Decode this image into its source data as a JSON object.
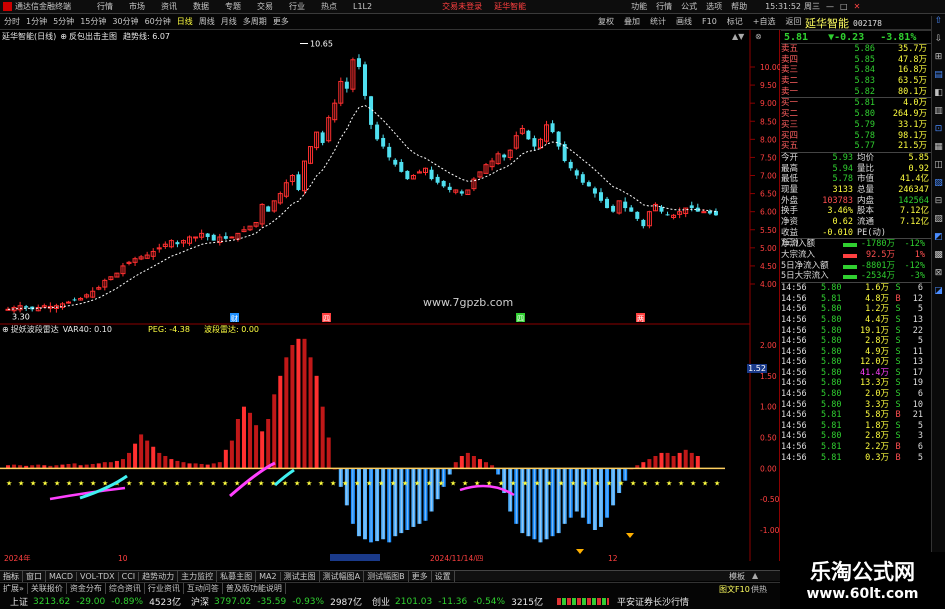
{
  "window": {
    "title": "通达信金融终端",
    "time": "15:31:52",
    "weekday": "周三",
    "menus": [
      "行情",
      "市场",
      "资讯",
      "数据",
      "专题",
      "交易",
      "行业",
      "热点",
      "L1L2"
    ],
    "right_menus": [
      "功能",
      "行情",
      "公式",
      "选项",
      "帮助"
    ],
    "center_links": [
      "交易未登录",
      "延华智能"
    ]
  },
  "toolbar": {
    "periods": [
      "分时",
      "1分钟",
      "5分钟",
      "15分钟",
      "30分钟",
      "60分钟",
      "日线",
      "周线",
      "月线",
      "多周期",
      "更多"
    ],
    "actions": [
      "复权",
      "叠加",
      "统计",
      "画线",
      "F10",
      "标记",
      "+自选",
      "返回"
    ]
  },
  "main_chart": {
    "legend": "延华智能(日线)",
    "legend2": "反包出击主图",
    "trend_label": "趋势线: 6.07",
    "high_label": "10.65",
    "low_label": "3.30",
    "watermark": "www.7gpzb.com",
    "marks": [
      "财",
      "四",
      "四",
      "两"
    ],
    "yticks": [
      "10.00",
      "9.50",
      "9.00",
      "8.50",
      "8.00",
      "7.50",
      "7.00",
      "6.50",
      "6.00",
      "5.50",
      "5.00",
      "4.50",
      "4.00"
    ]
  },
  "sub_chart": {
    "legend": "捉妖波段雷达",
    "var40": "VAR40: 0.10",
    "peg": "PEG: -4.38",
    "radar": "波段雷达: 0.00",
    "yticks": [
      "2.00",
      "1.50",
      "1.00",
      "0.50",
      "0.00",
      "-0.50",
      "-1.00"
    ],
    "cursor_value": "1.52",
    "xlabels": [
      "2024年",
      "10",
      "11",
      "2024/11/14/四",
      "12",
      "1"
    ]
  },
  "stock": {
    "name": "延华智能",
    "code": "002178",
    "price": "5.81",
    "change": "▼-0.23",
    "pct": "-3.81%",
    "asks": [
      {
        "l": "卖五",
        "p": "5.86",
        "v": "35.7万"
      },
      {
        "l": "卖四",
        "p": "5.85",
        "v": "47.8万"
      },
      {
        "l": "卖三",
        "p": "5.84",
        "v": "16.8万"
      },
      {
        "l": "卖二",
        "p": "5.83",
        "v": "63.5万"
      },
      {
        "l": "卖一",
        "p": "5.82",
        "v": "80.1万"
      }
    ],
    "bids": [
      {
        "l": "买一",
        "p": "5.81",
        "v": "4.0万"
      },
      {
        "l": "买二",
        "p": "5.80",
        "v": "264.9万"
      },
      {
        "l": "买三",
        "p": "5.79",
        "v": "33.1万"
      },
      {
        "l": "买四",
        "p": "5.78",
        "v": "98.1万"
      },
      {
        "l": "买五",
        "p": "5.77",
        "v": "21.5万"
      }
    ],
    "stats": [
      [
        "今开",
        "5.93",
        "均价",
        "5.85"
      ],
      [
        "最高",
        "5.94",
        "量比",
        "0.92"
      ],
      [
        "最低",
        "5.78",
        "市值",
        "41.4亿"
      ],
      [
        "现量",
        "3133",
        "总量",
        "246347"
      ],
      [
        "外盘",
        "103783",
        "内盘",
        "142564"
      ],
      [
        "换手",
        "3.46%",
        "股本",
        "7.12亿"
      ],
      [
        "净资",
        "0.62",
        "流通",
        "7.12亿"
      ],
      [
        "收益(三)",
        "-0.010",
        "PE(动)",
        ""
      ]
    ],
    "flows": [
      [
        "净流入额",
        "-1780万",
        "-12%"
      ],
      [
        "大宗流入",
        "92.5万",
        "1%"
      ],
      [
        "5日净流入额",
        "-8801万",
        "-12%"
      ],
      [
        "5日大宗流入",
        "-2534万",
        "-3%"
      ]
    ],
    "ticks": [
      [
        "14:56",
        "5.80",
        "1.6万",
        "S",
        "6"
      ],
      [
        "14:56",
        "5.81",
        "4.8万",
        "B",
        "12"
      ],
      [
        "14:56",
        "5.80",
        "1.2万",
        "S",
        "5"
      ],
      [
        "14:56",
        "5.80",
        "4.4万",
        "S",
        "13"
      ],
      [
        "14:56",
        "5.80",
        "19.1万",
        "S",
        "22"
      ],
      [
        "14:56",
        "5.80",
        "2.8万",
        "S",
        "5"
      ],
      [
        "14:56",
        "5.80",
        "4.9万",
        "S",
        "11"
      ],
      [
        "14:56",
        "5.80",
        "12.0万",
        "S",
        "13"
      ],
      [
        "14:56",
        "5.80",
        "41.4万",
        "S",
        "17"
      ],
      [
        "14:56",
        "5.80",
        "13.3万",
        "S",
        "19"
      ],
      [
        "14:56",
        "5.80",
        "2.0万",
        "S",
        "6"
      ],
      [
        "14:56",
        "5.80",
        "3.3万",
        "S",
        "10"
      ],
      [
        "14:56",
        "5.81",
        "5.8万",
        "B",
        "21"
      ],
      [
        "14:56",
        "5.81",
        "1.8万",
        "S",
        "5"
      ],
      [
        "14:56",
        "5.80",
        "2.8万",
        "S",
        "3"
      ],
      [
        "14:56",
        "5.81",
        "2.2万",
        "B",
        "6"
      ],
      [
        "14:56",
        "5.81",
        "0.3万",
        "B",
        "5"
      ]
    ]
  },
  "bottom_tabs": [
    "指标",
    "窗口",
    "MACD",
    "VOL-TDX",
    "CCI",
    "趋势动力",
    "主力监控",
    "私募主图",
    "MA2",
    "测试主图",
    "测试幅图A",
    "测试幅图B",
    "更多",
    "设置"
  ],
  "bottom_tabs2": [
    "扩展»",
    "关联报价",
    "资金分布",
    "综合资讯",
    "行业资讯",
    "互动问答",
    "普及版功能说明"
  ],
  "right_tabs": [
    "模板",
    "图文F10",
    "供热"
  ],
  "index_bar": {
    "sh_label": "上证",
    "sh": "3213.62",
    "sh_chg": "-29.00",
    "sh_pct": "-0.89%",
    "sh_amt": "4523亿",
    "sz_label": "沪深",
    "sz": "3797.02",
    "sz_chg": "-35.59",
    "sz_pct": "-0.93%",
    "sz_amt": "2987亿",
    "cy_label": "创业",
    "cy": "2101.03",
    "cy_chg": "-11.36",
    "cy_pct": "-0.54%",
    "cy_amt": "3215亿",
    "broker": "平安证券长沙行情"
  },
  "site_watermark": {
    "line1": "乐淘公式网",
    "line2": "www.60lt.com"
  }
}
